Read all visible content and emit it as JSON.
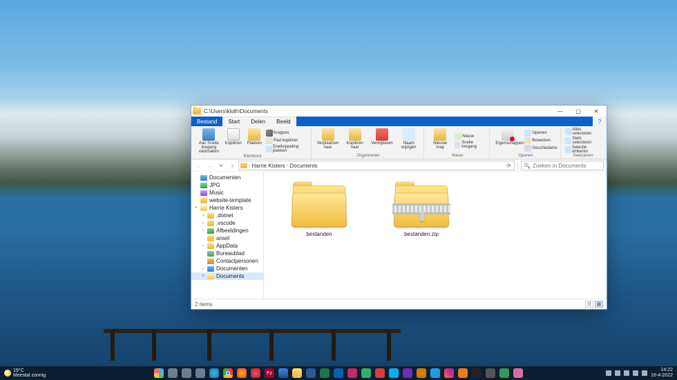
{
  "weather": {
    "temp": "19°C",
    "desc": "Meestal zonnig"
  },
  "window": {
    "title": "C:\\Users\\kloth\\Documents",
    "wincontrols": {
      "min": "—",
      "max": "▢",
      "close": "✕"
    },
    "menubar": {
      "file": "Bestand",
      "start": "Start",
      "share": "Delen",
      "view": "Beeld",
      "help": "?"
    },
    "ribbon": {
      "clipboard": {
        "label": "Klembord",
        "pin": "Aan Snelle toegang vastmaken",
        "copy": "Kopiëren",
        "paste": "Plakken",
        "cut": "Knippen",
        "copypath": "Pad kopiëren",
        "pastelink": "Snelkoppeling plakken"
      },
      "organize": {
        "label": "Organiseren",
        "move": "Verplaatsen naar",
        "copy": "Kopiëren naar",
        "delete": "Verwijderen",
        "rename": "Naam wijzigen"
      },
      "new": {
        "label": "Nieuw",
        "newfolder": "Nieuwe map",
        "newitem": "Nieuw",
        "easyaccess": "Snelle toegang"
      },
      "open": {
        "label": "Openen",
        "properties": "Eigenschappen",
        "open": "Openen",
        "edit": "Bewerken",
        "history": "Geschiedenis"
      },
      "select": {
        "label": "Selecteren",
        "all": "Alles selecteren",
        "none": "Niets selecteren",
        "invert": "Selectie omkeren"
      }
    },
    "address": {
      "back": "←",
      "fwd": "→",
      "recent": "˅",
      "up": "↑",
      "crumbs": [
        "Harrie Kisters",
        "Documents"
      ],
      "refresh": "⟳",
      "searchPlaceholder": "Zoeken in Documents",
      "searchIcon": "🔍"
    },
    "tree": [
      {
        "depth": 0,
        "icon": "doc",
        "label": "Documenten",
        "exp": ""
      },
      {
        "depth": 0,
        "icon": "img",
        "label": "JPG",
        "exp": ""
      },
      {
        "depth": 0,
        "icon": "music",
        "label": "Music",
        "exp": ""
      },
      {
        "depth": 0,
        "icon": "folder",
        "label": "website-template",
        "exp": ""
      },
      {
        "depth": 0,
        "icon": "folder-o",
        "label": "Harrie Kisters",
        "exp": "˅"
      },
      {
        "depth": 1,
        "icon": "folder",
        "label": ".dotnet",
        "exp": "›"
      },
      {
        "depth": 1,
        "icon": "folder",
        "label": ".vscode",
        "exp": "›"
      },
      {
        "depth": 1,
        "icon": "img",
        "label": "Afbeeldingen",
        "exp": "›"
      },
      {
        "depth": 1,
        "icon": "folder",
        "label": "ansel",
        "exp": ""
      },
      {
        "depth": 1,
        "icon": "folder",
        "label": "AppData",
        "exp": "›"
      },
      {
        "depth": 1,
        "icon": "green",
        "label": "Bureaublad",
        "exp": ""
      },
      {
        "depth": 1,
        "icon": "contact",
        "label": "Contactpersonen",
        "exp": ""
      },
      {
        "depth": 1,
        "icon": "doc",
        "label": "Documenten",
        "exp": "›"
      },
      {
        "depth": 1,
        "icon": "folder-o",
        "label": "Documents",
        "exp": "˅",
        "selected": true
      }
    ],
    "items": [
      {
        "kind": "folder",
        "label": "bestanden"
      },
      {
        "kind": "zip",
        "label": "bestanden.zip"
      }
    ],
    "status": {
      "count": "2 items"
    }
  },
  "clock": {
    "time": "14:22",
    "date": "18-4-2022"
  }
}
